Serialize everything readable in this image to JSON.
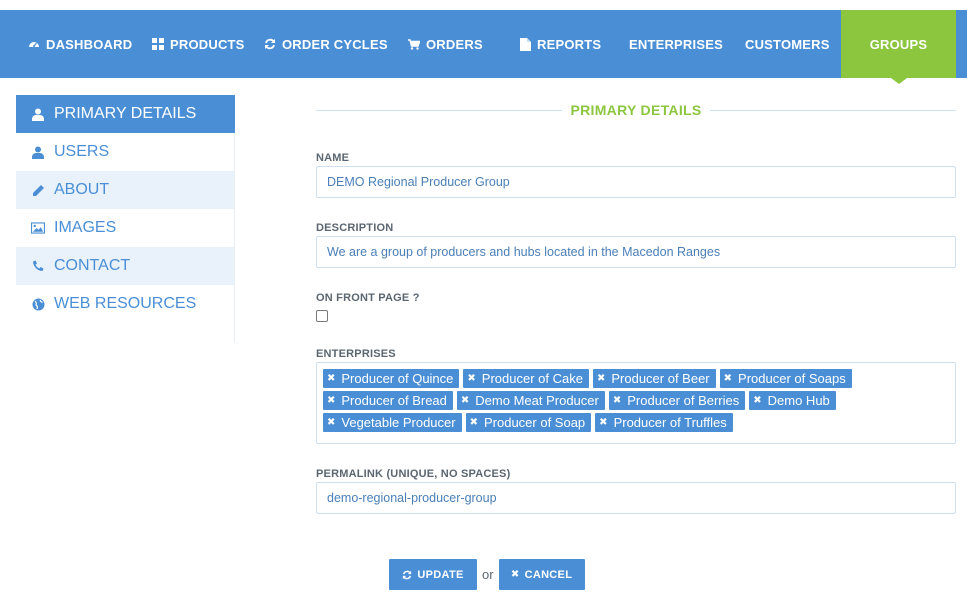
{
  "nav": {
    "dashboard": "DASHBOARD",
    "products": "PRODUCTS",
    "order_cycles": "ORDER CYCLES",
    "orders": "ORDERS",
    "reports": "REPORTS",
    "enterprises": "ENTERPRISES",
    "customers": "CUSTOMERS",
    "groups": "GROUPS"
  },
  "sidebar": {
    "items": [
      {
        "label": "PRIMARY DETAILS",
        "icon": "user-icon"
      },
      {
        "label": "USERS",
        "icon": "user-icon"
      },
      {
        "label": "ABOUT",
        "icon": "pencil-icon"
      },
      {
        "label": "IMAGES",
        "icon": "image-icon"
      },
      {
        "label": "CONTACT",
        "icon": "phone-icon"
      },
      {
        "label": "WEB RESOURCES",
        "icon": "globe-icon"
      }
    ]
  },
  "form": {
    "section_title": "PRIMARY DETAILS",
    "name_label": "NAME",
    "name_value": "DEMO Regional Producer Group",
    "description_label": "DESCRIPTION",
    "description_value": "We are a group of producers and hubs located in the Macedon Ranges",
    "front_page_label": "ON FRONT PAGE ?",
    "front_page_checked": false,
    "enterprises_label": "ENTERPRISES",
    "enterprises": [
      "Producer of Quince",
      "Producer of Cake",
      "Producer of Beer",
      "Producer of Soaps",
      "Producer of Bread",
      "Demo Meat Producer",
      "Producer of Berries",
      "Demo Hub",
      "Vegetable Producer",
      "Producer of Soap",
      "Producer of Truffles"
    ],
    "permalink_label": "PERMALINK (UNIQUE, NO SPACES)",
    "permalink_value": "demo-regional-producer-group"
  },
  "actions": {
    "update": "UPDATE",
    "or": "or",
    "cancel": "CANCEL"
  },
  "colors": {
    "nav_blue": "#4a8fd6",
    "active_green": "#8cc63f",
    "sidebar_alt": "#e9f1fa"
  }
}
